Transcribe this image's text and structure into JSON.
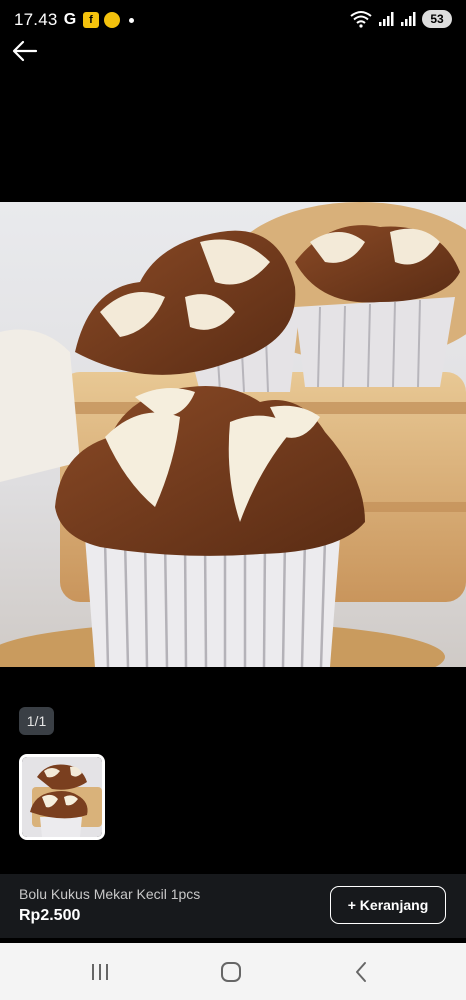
{
  "status_bar": {
    "time": "17.43",
    "g_icon": "G",
    "app_icon_1": "f",
    "app_icon_2": "ojek",
    "battery": "53",
    "icons": [
      "google-icon",
      "app-notification-icon",
      "wifi-icon",
      "signal-icon",
      "signal-icon",
      "battery-icon"
    ]
  },
  "header": {
    "back_icon": "arrow-left-icon"
  },
  "gallery": {
    "page_indicator": "1/1"
  },
  "product": {
    "name": "Bolu Kukus Mekar Kecil 1pcs",
    "price": "Rp2.500",
    "cart_button_label": "+ Keranjang"
  },
  "nav_bar": {
    "icons": [
      "recent-apps-icon",
      "home-icon",
      "back-icon"
    ]
  },
  "colors": {
    "background": "#000000",
    "bottom_bar": "#17191c",
    "nav_bar": "#f4f4f4"
  }
}
